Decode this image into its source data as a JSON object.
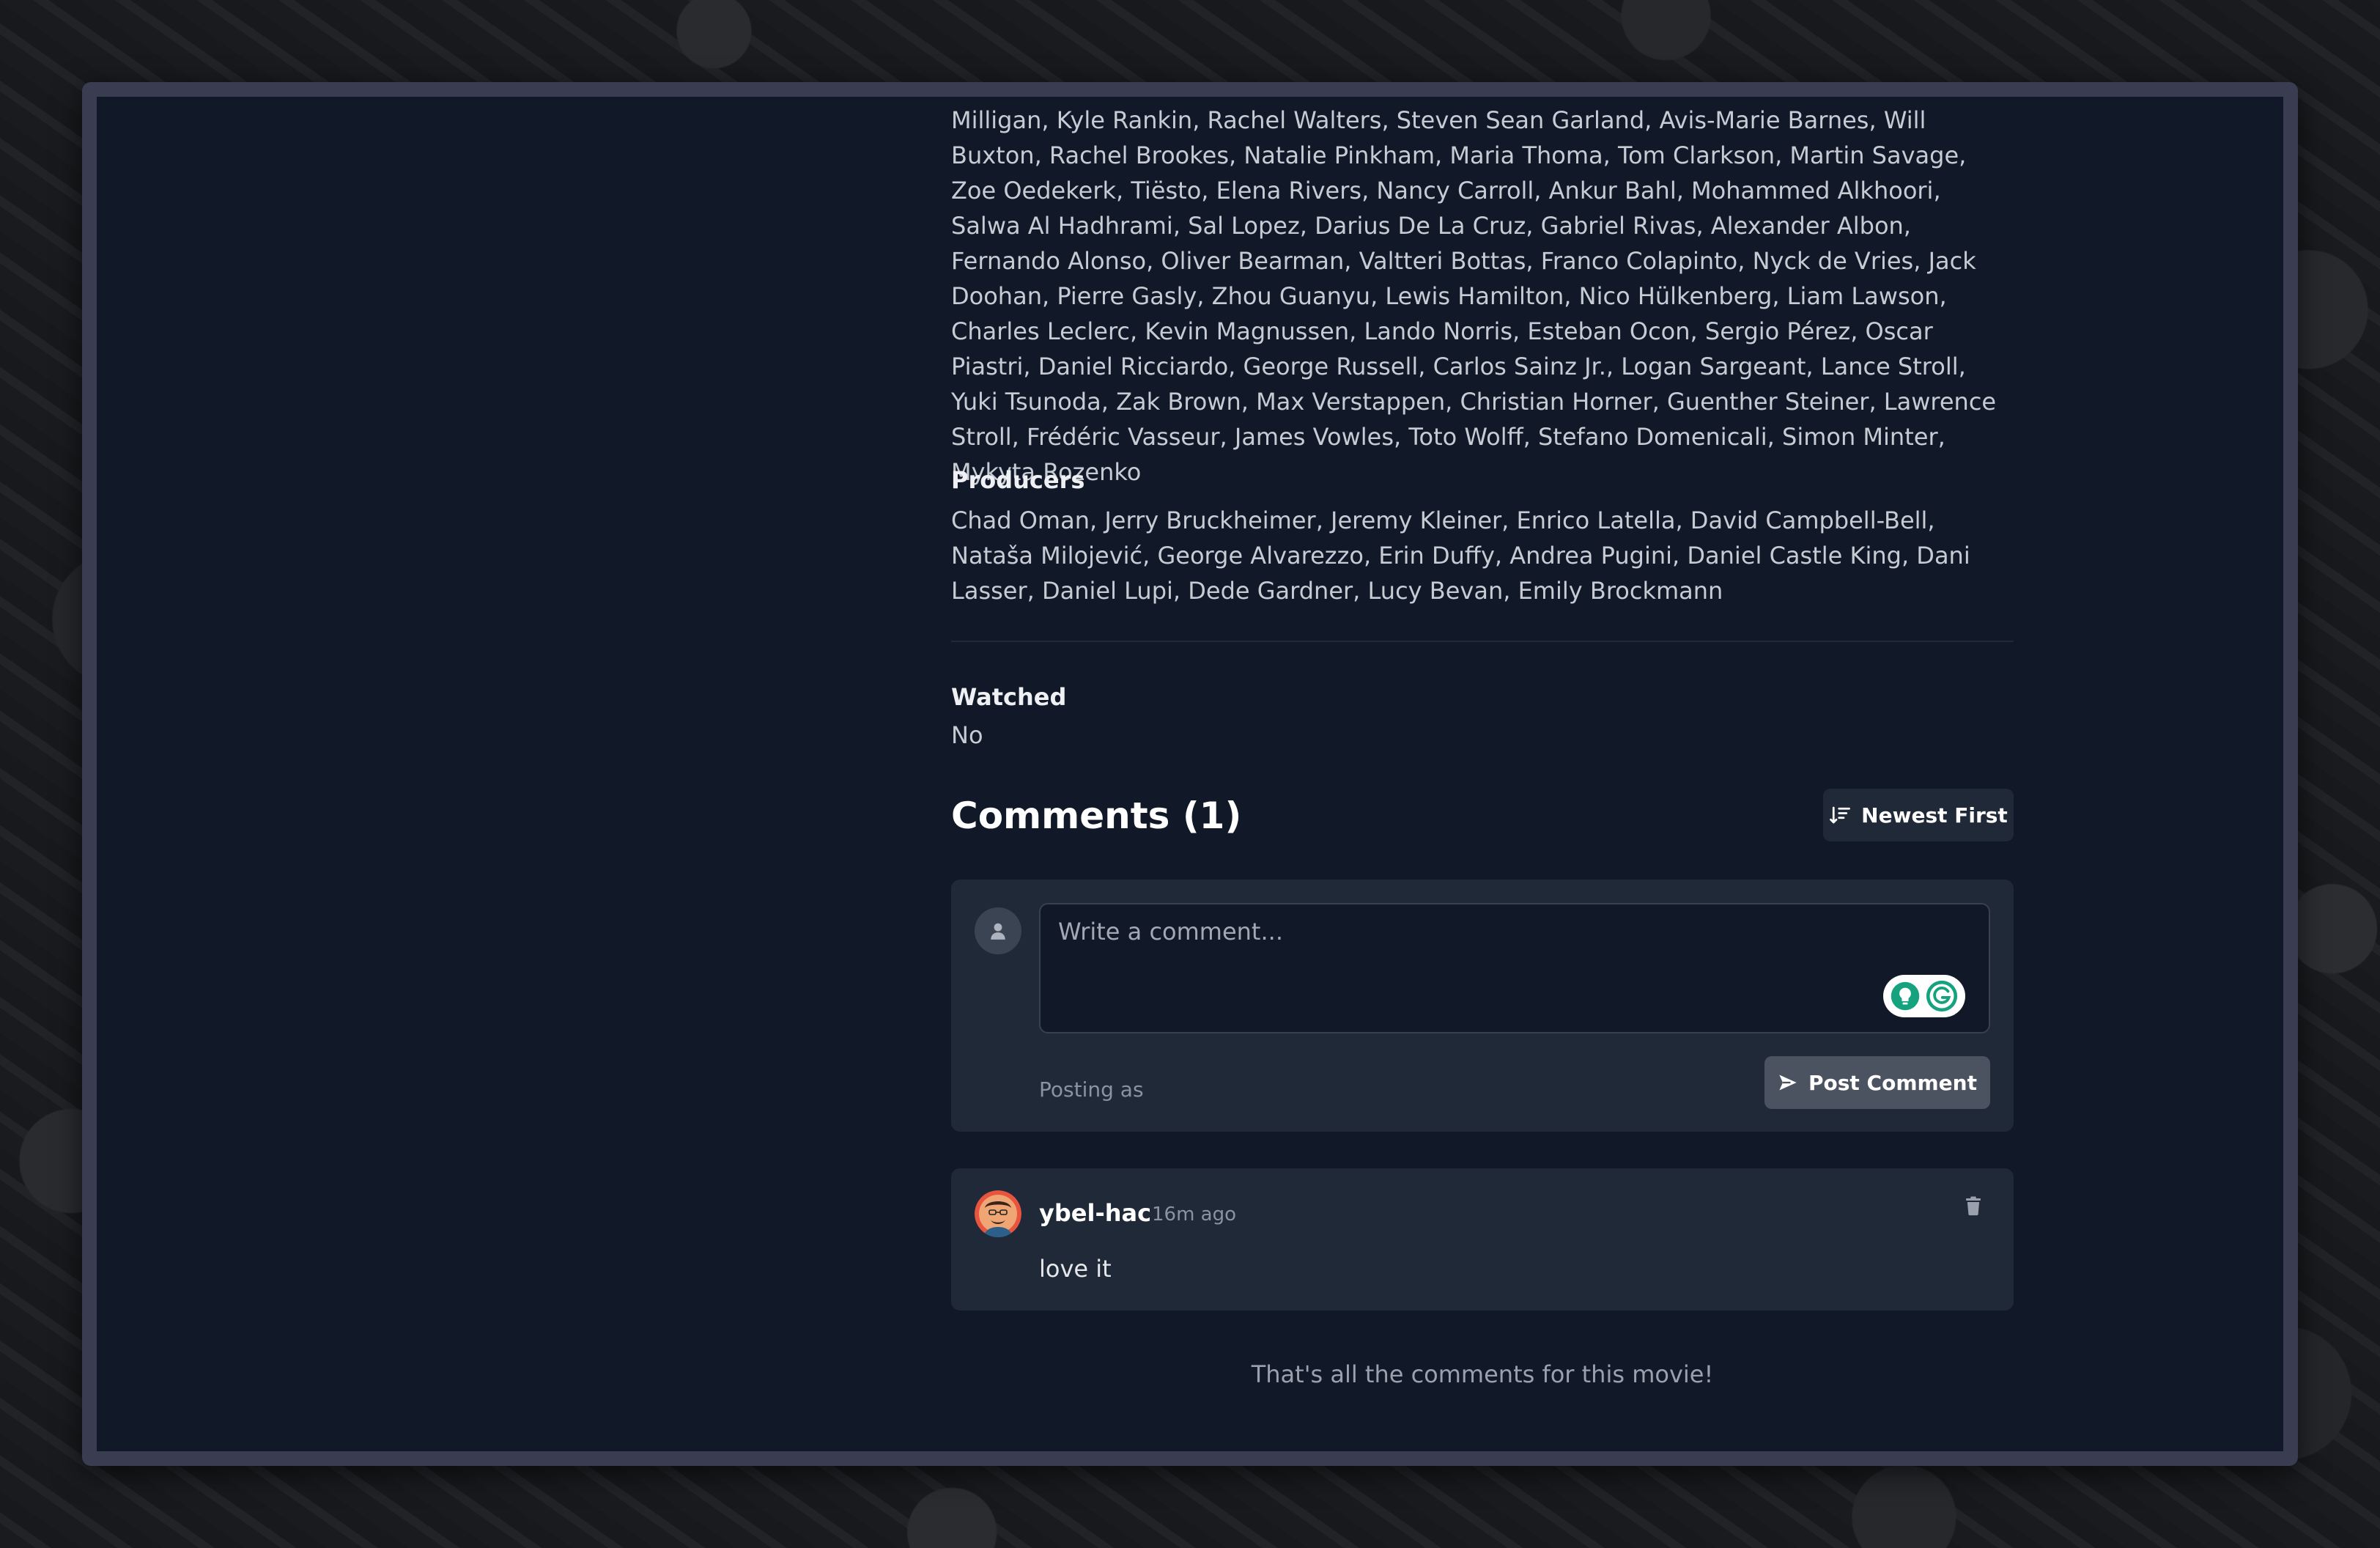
{
  "cast": {
    "text": "Milligan, Kyle Rankin, Rachel Walters, Steven Sean Garland, Avis-Marie Barnes, Will Buxton, Rachel Brookes, Natalie Pinkham, Maria Thoma, Tom Clarkson, Martin Savage, Zoe Oedekerk, Tiësto, Elena Rivers, Nancy Carroll, Ankur Bahl, Mohammed Alkhoori, Salwa Al Hadhrami, Sal Lopez, Darius De La Cruz, Gabriel Rivas, Alexander Albon, Fernando Alonso, Oliver Bearman, Valtteri Bottas, Franco Colapinto, Nyck de Vries, Jack Doohan, Pierre Gasly, Zhou Guanyu, Lewis Hamilton, Nico Hülkenberg, Liam Lawson, Charles Leclerc, Kevin Magnussen, Lando Norris, Esteban Ocon, Sergio Pérez, Oscar Piastri, Daniel Ricciardo, George Russell, Carlos Sainz Jr., Logan Sargeant, Lance Stroll, Yuki Tsunoda, Zak Brown, Max Verstappen, Christian Horner, Guenther Steiner, Lawrence Stroll, Frédéric Vasseur, James Vowles, Toto Wolff, Stefano Domenicali, Simon Minter, Mykyta Rozenko"
  },
  "producers": {
    "label": "Producers",
    "text": "Chad Oman, Jerry Bruckheimer, Jeremy Kleiner, Enrico Latella, David Campbell-Bell, Nataša Milojević, George Alvarezzo, Erin Duffy, Andrea Pugini, Daniel Castle King, Dani Lasser, Daniel Lupi, Dede Gardner, Lucy Bevan, Emily Brockmann"
  },
  "watched": {
    "label": "Watched",
    "value": "No"
  },
  "comments": {
    "title": "Comments (1)",
    "sort_label": "Newest First",
    "composer": {
      "placeholder": "Write a comment...",
      "posting_as": "Posting as",
      "post_label": "Post Comment"
    },
    "items": [
      {
        "author": "ybel-hac",
        "time": "16m ago",
        "body": "love it"
      }
    ],
    "end_note": "That's all the comments for this movie!"
  },
  "colors": {
    "panel_bg": "#111827",
    "card_bg": "#1f2937",
    "window_frame": "#3a3c52",
    "grammarly_green": "#15a37f"
  }
}
